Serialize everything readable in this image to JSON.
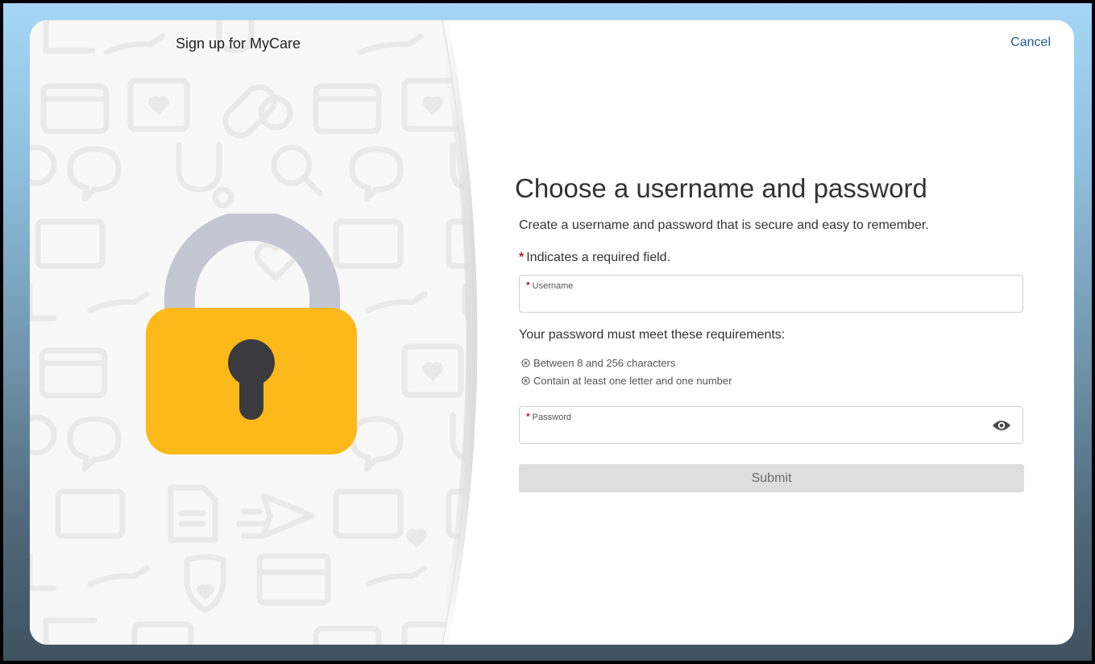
{
  "header": {
    "app_title": "Sign up for MyCare",
    "cancel_label": "Cancel"
  },
  "illustration": {
    "icon": "padlock-icon",
    "background_icons": [
      "calendar-icon",
      "folder-heart-icon",
      "pill-icon",
      "chat-icon",
      "stethoscope-icon",
      "search-icon",
      "id-card-icon",
      "heart-hand-icon",
      "shield-heart-icon",
      "document-icon",
      "paper-plane-icon"
    ]
  },
  "form": {
    "heading": "Choose a username and password",
    "subtext": "Create a username and password that is secure and easy to remember.",
    "required_marker": "*",
    "required_note": "Indicates a required field.",
    "username": {
      "label": "Username",
      "value": ""
    },
    "password_requirements": {
      "heading": "Your password must meet these requirements:",
      "items": [
        {
          "text": "Between 8 and 256 characters",
          "icon": "circle-x-icon"
        },
        {
          "text": "Contain at least one letter and one number",
          "icon": "circle-x-icon"
        }
      ]
    },
    "password": {
      "label": "Password",
      "value": "",
      "toggle_icon": "eye-icon"
    },
    "submit_label": "Submit"
  },
  "colors": {
    "accent_link": "#1f5e8f",
    "required_star": "#b41f2f",
    "lock_body": "#fcb919",
    "lock_shackle": "#c3c7d1",
    "keyhole": "#3b3b3f",
    "submit_disabled_bg": "#dedede"
  }
}
